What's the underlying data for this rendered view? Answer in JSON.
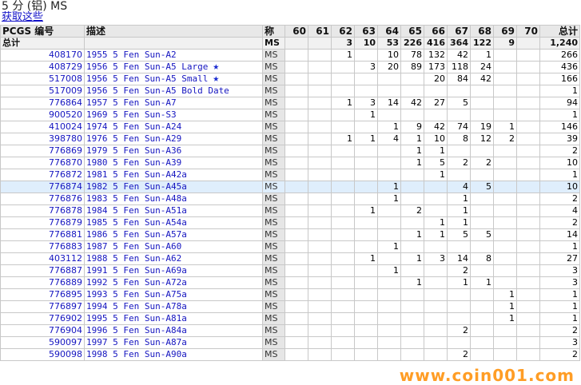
{
  "page": {
    "title": "5 分 (铝) MS",
    "link": "获取这些"
  },
  "table": {
    "headers": [
      "PCGS 编号",
      "描述",
      "称",
      "60",
      "61",
      "62",
      "63",
      "64",
      "65",
      "66",
      "67",
      "68",
      "69",
      "70",
      "总计"
    ],
    "total_row": {
      "label": "总计",
      "ms": "MS",
      "grades": [
        "",
        "",
        "3",
        "10",
        "53",
        "226",
        "416",
        "364",
        "122",
        "9",
        ""
      ],
      "total": "1,240"
    },
    "rows": [
      {
        "pcgs": "408170",
        "desc": "1955 5 Fen Sun-A2",
        "ms": "MS",
        "star": "",
        "grades": [
          "",
          "",
          "1",
          "",
          "10",
          "78",
          "132",
          "42",
          "1",
          "",
          ""
        ],
        "total": "266"
      },
      {
        "pcgs": "408729",
        "desc": "1956 5 Fen Sun-A5 Large",
        "ms": "MS",
        "star": "★",
        "grades": [
          "",
          "",
          "",
          "3",
          "20",
          "89",
          "173",
          "118",
          "24",
          "",
          ""
        ],
        "total": "436"
      },
      {
        "pcgs": "517008",
        "desc": "1956 5 Fen Sun-A5 Small",
        "ms": "MS",
        "star": "★",
        "grades": [
          "",
          "",
          "",
          "",
          "",
          "",
          "20",
          "84",
          "42",
          "",
          ""
        ],
        "total": "166"
      },
      {
        "pcgs": "517009",
        "desc": "1956 5 Fen Sun-A5 Bold Date",
        "ms": "MS",
        "star": "",
        "grades": [
          "",
          "",
          "",
          "",
          "",
          "",
          "",
          "",
          "",
          "",
          ""
        ],
        "total": "1"
      },
      {
        "pcgs": "776864",
        "desc": "1957 5 Fen Sun-A7",
        "ms": "MS",
        "star": "",
        "grades": [
          "",
          "",
          "1",
          "3",
          "14",
          "42",
          "27",
          "5",
          "",
          "",
          ""
        ],
        "total": "94"
      },
      {
        "pcgs": "900520",
        "desc": "1969 5 Fen Sun-S3",
        "ms": "MS",
        "star": "",
        "grades": [
          "",
          "",
          "",
          "1",
          "",
          "",
          "",
          "",
          "",
          "",
          ""
        ],
        "total": "1"
      },
      {
        "pcgs": "410024",
        "desc": "1974 5 Fen Sun-A24",
        "ms": "MS",
        "star": "",
        "grades": [
          "",
          "",
          "",
          "",
          "1",
          "9",
          "42",
          "74",
          "19",
          "1",
          ""
        ],
        "total": "146"
      },
      {
        "pcgs": "398780",
        "desc": "1976 5 Fen Sun-A29",
        "ms": "MS",
        "star": "",
        "grades": [
          "",
          "",
          "1",
          "1",
          "4",
          "1",
          "10",
          "8",
          "12",
          "2",
          ""
        ],
        "total": "39"
      },
      {
        "pcgs": "776869",
        "desc": "1979 5 Fen Sun-A36",
        "ms": "MS",
        "star": "",
        "grades": [
          "",
          "",
          "",
          "",
          "",
          "1",
          "1",
          "",
          "",
          "",
          ""
        ],
        "total": "2"
      },
      {
        "pcgs": "776870",
        "desc": "1980 5 Fen Sun-A39",
        "ms": "MS",
        "star": "",
        "grades": [
          "",
          "",
          "",
          "",
          "",
          "1",
          "5",
          "2",
          "2",
          "",
          ""
        ],
        "total": "10"
      },
      {
        "pcgs": "776872",
        "desc": "1981 5 Fen Sun-A42a",
        "ms": "MS",
        "star": "",
        "grades": [
          "",
          "",
          "",
          "",
          "",
          "",
          "1",
          "",
          "",
          "",
          ""
        ],
        "total": "1"
      },
      {
        "pcgs": "776874",
        "desc": "1982 5 Fen Sun-A45a",
        "ms": "MS",
        "star": "",
        "grades": [
          "",
          "",
          "",
          "",
          "1",
          "",
          "",
          "4",
          "5",
          "",
          ""
        ],
        "total": "10"
      },
      {
        "pcgs": "776876",
        "desc": "1983 5 Fen Sun-A48a",
        "ms": "MS",
        "star": "",
        "grades": [
          "",
          "",
          "",
          "",
          "1",
          "",
          "",
          "1",
          "",
          "",
          ""
        ],
        "total": "2"
      },
      {
        "pcgs": "776878",
        "desc": "1984 5 Fen Sun-A51a",
        "ms": "MS",
        "star": "",
        "grades": [
          "",
          "",
          "",
          "1",
          "",
          "2",
          "",
          "1",
          "",
          "",
          ""
        ],
        "total": "4"
      },
      {
        "pcgs": "776879",
        "desc": "1985 5 Fen Sun-A54a",
        "ms": "MS",
        "star": "",
        "grades": [
          "",
          "",
          "",
          "",
          "",
          "",
          "1",
          "1",
          "",
          "",
          ""
        ],
        "total": "2"
      },
      {
        "pcgs": "776881",
        "desc": "1986 5 Fen Sun-A57a",
        "ms": "MS",
        "star": "",
        "grades": [
          "",
          "",
          "",
          "",
          "",
          "1",
          "1",
          "5",
          "5",
          "",
          ""
        ],
        "total": "14"
      },
      {
        "pcgs": "776883",
        "desc": "1987 5 Fen Sun-A60",
        "ms": "MS",
        "star": "",
        "grades": [
          "",
          "",
          "",
          "",
          "1",
          "",
          "",
          "",
          "",
          "",
          ""
        ],
        "total": "1"
      },
      {
        "pcgs": "403112",
        "desc": "1988 5 Fen Sun-A62",
        "ms": "MS",
        "star": "",
        "grades": [
          "",
          "",
          "",
          "1",
          "",
          "1",
          "3",
          "14",
          "8",
          "",
          ""
        ],
        "total": "27"
      },
      {
        "pcgs": "776887",
        "desc": "1991 5 Fen Sun-A69a",
        "ms": "MS",
        "star": "",
        "grades": [
          "",
          "",
          "",
          "",
          "1",
          "",
          "",
          "2",
          "",
          "",
          ""
        ],
        "total": "3"
      },
      {
        "pcgs": "776889",
        "desc": "1992 5 Fen Sun-A72a",
        "ms": "MS",
        "star": "",
        "grades": [
          "",
          "",
          "",
          "",
          "",
          "1",
          "",
          "1",
          "1",
          "",
          ""
        ],
        "total": "3"
      },
      {
        "pcgs": "776895",
        "desc": "1993 5 Fen Sun-A75a",
        "ms": "MS",
        "star": "",
        "grades": [
          "",
          "",
          "",
          "",
          "",
          "",
          "",
          "",
          "",
          "1",
          ""
        ],
        "total": "1"
      },
      {
        "pcgs": "776897",
        "desc": "1994 5 Fen Sun-A78a",
        "ms": "MS",
        "star": "",
        "grades": [
          "",
          "",
          "",
          "",
          "",
          "",
          "",
          "",
          "",
          "1",
          ""
        ],
        "total": "1"
      },
      {
        "pcgs": "776902",
        "desc": "1995 5 Fen Sun-A81a",
        "ms": "MS",
        "star": "",
        "grades": [
          "",
          "",
          "",
          "",
          "",
          "",
          "",
          "",
          "",
          "1",
          ""
        ],
        "total": "1"
      },
      {
        "pcgs": "776904",
        "desc": "1996 5 Fen Sun-A84a",
        "ms": "MS",
        "star": "",
        "grades": [
          "",
          "",
          "",
          "",
          "",
          "",
          "",
          "2",
          "",
          "",
          ""
        ],
        "total": "2"
      },
      {
        "pcgs": "590097",
        "desc": "1997 5 Fen Sun-A87a",
        "ms": "MS",
        "star": "",
        "grades": [
          "",
          "",
          "",
          "",
          "",
          "",
          "",
          "",
          "",
          "",
          ""
        ],
        "total": "3"
      },
      {
        "pcgs": "590098",
        "desc": "1998 5 Fen Sun-A90a",
        "ms": "MS",
        "star": "",
        "grades": [
          "",
          "",
          "",
          "",
          "",
          "",
          "",
          "2",
          "",
          "",
          ""
        ],
        "total": "2"
      }
    ],
    "selected_row": 11
  },
  "watermark": "www.coin001.com",
  "colors": {
    "link": "#1515c0",
    "header_bg": "#e8e8e8",
    "ms_cell_bg": "#e6e6e6",
    "selected_row_bg": "#dfeefc",
    "watermark": "#ff8c00"
  }
}
